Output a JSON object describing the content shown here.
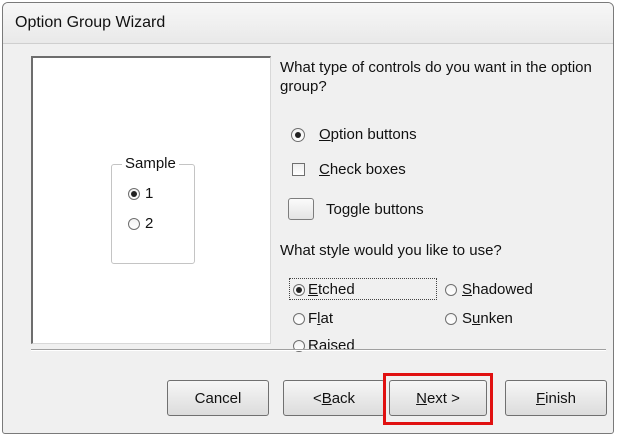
{
  "window": {
    "title": "Option Group Wizard"
  },
  "sample": {
    "legend": "Sample",
    "options": [
      {
        "label": "1",
        "checked": true
      },
      {
        "label": "2",
        "checked": false
      }
    ]
  },
  "controls": {
    "question": "What type of controls do you want in the option group?",
    "option_buttons": {
      "access_key": "O",
      "rest": "ption buttons",
      "selected": true
    },
    "check_boxes": {
      "access_key": "C",
      "rest": "heck boxes",
      "selected": false
    },
    "toggle_buttons": {
      "label": "Toggle buttons",
      "selected": false
    }
  },
  "style": {
    "question": "What style would you like to use?",
    "etched": {
      "access_key": "E",
      "rest": "tched",
      "selected": true
    },
    "shadowed": {
      "access_key": "S",
      "rest": "hadowed",
      "selected": false
    },
    "flat": {
      "pre": "F",
      "access_key": "l",
      "rest": "at",
      "selected": false
    },
    "sunken": {
      "pre": "S",
      "access_key": "u",
      "rest": "nken",
      "selected": false
    },
    "raised": {
      "label": "Raised",
      "selected": false
    }
  },
  "buttons": {
    "cancel": "Cancel",
    "back": {
      "pre": "< ",
      "access_key": "B",
      "rest": "ack"
    },
    "next": {
      "access_key": "N",
      "rest": "ext >"
    },
    "finish": {
      "access_key": "F",
      "rest": "inish"
    }
  },
  "highlight_color": "#e01010"
}
